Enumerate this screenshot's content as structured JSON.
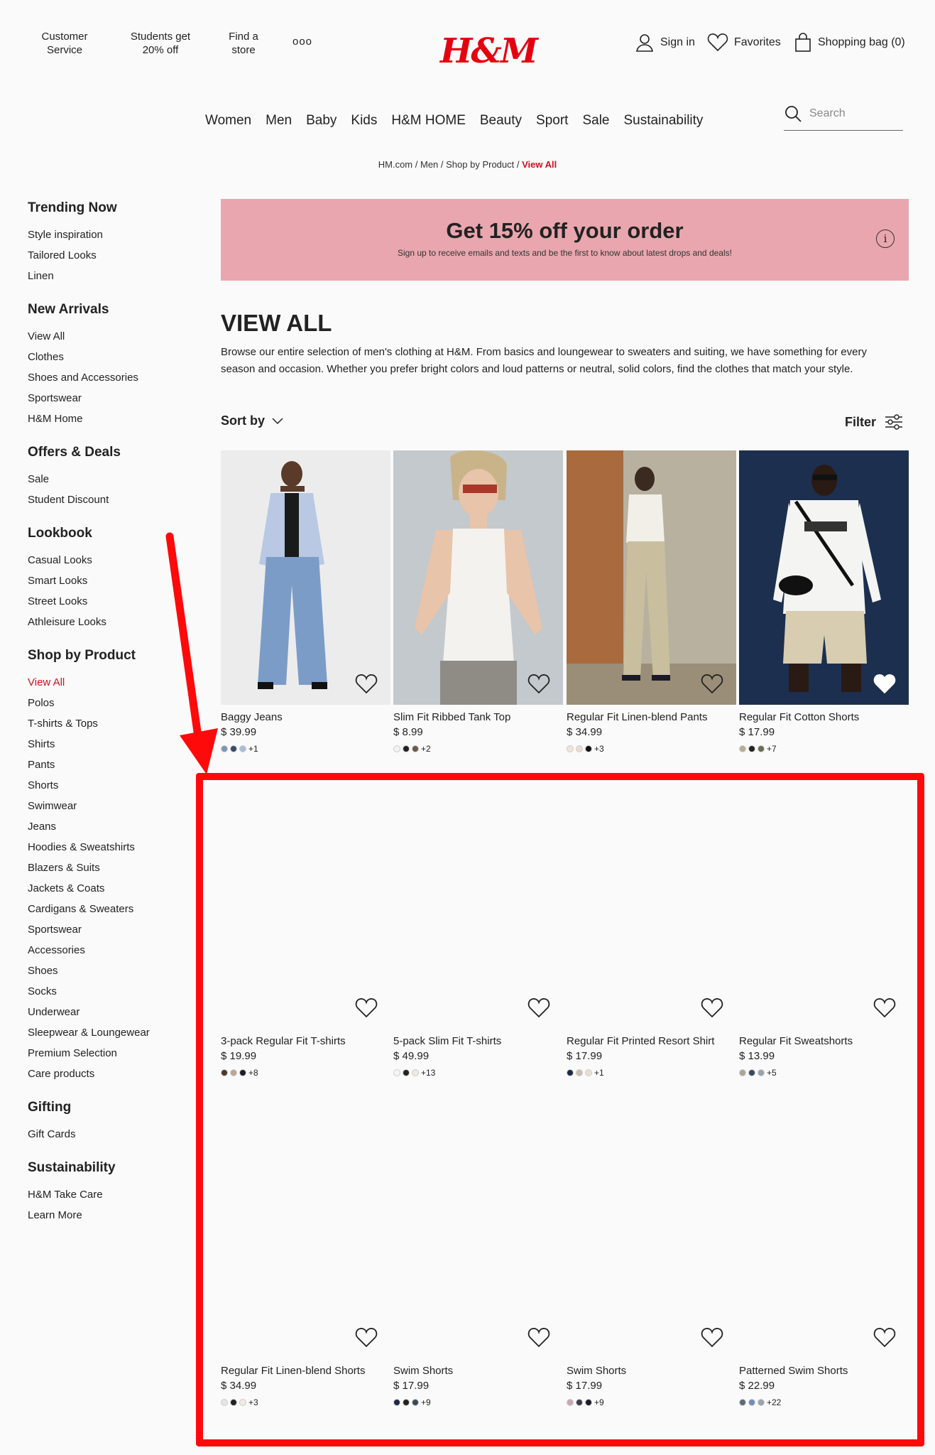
{
  "header": {
    "links": [
      "Customer Service",
      "Students get 20% off",
      "Find a store"
    ],
    "more": "ooo",
    "logo": "H&M",
    "sign_in": "Sign in",
    "favorites": "Favorites",
    "bag": "Shopping bag (0)"
  },
  "nav": [
    "Women",
    "Men",
    "Baby",
    "Kids",
    "H&M HOME",
    "Beauty",
    "Sport",
    "Sale",
    "Sustainability"
  ],
  "search": {
    "placeholder": "Search"
  },
  "breadcrumb": {
    "items": [
      "HM.com",
      "Men",
      "Shop by Product"
    ],
    "current": "View All"
  },
  "sidebar": [
    {
      "title": "Trending Now",
      "items": [
        "Style inspiration",
        "Tailored Looks",
        "Linen"
      ]
    },
    {
      "title": "New Arrivals",
      "items": [
        "View All",
        "Clothes",
        "Shoes and Accessories",
        "Sportswear",
        "H&M Home"
      ]
    },
    {
      "title": "Offers & Deals",
      "items": [
        "Sale",
        "Student Discount"
      ]
    },
    {
      "title": "Lookbook",
      "items": [
        "Casual Looks",
        "Smart Looks",
        "Street Looks",
        "Athleisure Looks"
      ]
    },
    {
      "title": "Shop by Product",
      "items": [
        "View All",
        "Polos",
        "T-shirts & Tops",
        "Shirts",
        "Pants",
        "Shorts",
        "Swimwear",
        "Jeans",
        "Hoodies & Sweatshirts",
        "Blazers & Suits",
        "Jackets & Coats",
        "Cardigans & Sweaters",
        "Sportswear",
        "Accessories",
        "Shoes",
        "Socks",
        "Underwear",
        "Sleepwear & Loungewear",
        "Premium Selection",
        "Care products"
      ]
    },
    {
      "title": "Gifting",
      "items": [
        "Gift Cards"
      ]
    },
    {
      "title": "Sustainability",
      "items": [
        "H&M Take Care",
        "Learn More"
      ]
    }
  ],
  "promo": {
    "title": "Get 15% off your order",
    "subtitle": "Sign up to receive emails and texts and be the first to know about latest drops and deals!"
  },
  "page": {
    "title": "VIEW ALL",
    "description": "Browse our entire selection of men's clothing at H&M. From basics and loungewear to sweaters and suiting, we have something for every season and occasion. Whether you prefer bright colors and loud patterns or neutral, solid colors, find the clothes that match your style.",
    "sort": "Sort by",
    "filter": "Filter"
  },
  "products": [
    {
      "name": "Baggy Jeans",
      "price": "$ 39.99",
      "swatches": [
        "#7e95b8",
        "#3b4a66",
        "#a9bdd6"
      ],
      "more": "+1",
      "bg": "#ececec",
      "image": "jeans"
    },
    {
      "name": "Slim Fit Ribbed Tank Top",
      "price": "$ 8.99",
      "swatches": [
        "#f2f2f2",
        "#222222",
        "#6a5a4a"
      ],
      "more": "+2",
      "bg": "#c3c9cc",
      "image": "tank"
    },
    {
      "name": "Regular Fit Linen-blend Pants",
      "price": "$ 34.99",
      "swatches": [
        "#efe6d6",
        "#e8ddd0",
        "#111111"
      ],
      "more": "+3",
      "bg": "#9a8f7a",
      "image": "linen"
    },
    {
      "name": "Regular Fit Cotton Shorts",
      "price": "$ 17.99",
      "swatches": [
        "#b8ad93",
        "#222222",
        "#6b6b55"
      ],
      "more": "+7",
      "bg": "#1c2f4f",
      "image": "shorts"
    },
    {
      "name": "3-pack Regular Fit T-shirts",
      "price": "$ 19.99",
      "swatches": [
        "#4a3b30",
        "#b7a89a",
        "#1c1c2a"
      ],
      "more": "+8",
      "bg": "#fafafa",
      "image": ""
    },
    {
      "name": "5-pack Slim Fit T-shirts",
      "price": "$ 49.99",
      "swatches": [
        "#f5f5f5",
        "#222222",
        "#efe9df"
      ],
      "more": "+13",
      "bg": "#fafafa",
      "image": ""
    },
    {
      "name": "Regular Fit Printed Resort Shirt",
      "price": "$ 17.99",
      "swatches": [
        "#1e2a44",
        "#c8bfae",
        "#e8e0d2"
      ],
      "more": "+1",
      "bg": "#fafafa",
      "image": ""
    },
    {
      "name": "Regular Fit Sweatshorts",
      "price": "$ 13.99",
      "swatches": [
        "#a6a69a",
        "#3a4a5a",
        "#9aa3ab"
      ],
      "more": "+5",
      "bg": "#fafafa",
      "image": ""
    },
    {
      "name": "Regular Fit Linen-blend Shorts",
      "price": "$ 34.99",
      "swatches": [
        "#e5e5e5",
        "#222222",
        "#f0ebe1"
      ],
      "more": "+3",
      "bg": "#fafafa",
      "image": ""
    },
    {
      "name": "Swim Shorts",
      "price": "$ 17.99",
      "swatches": [
        "#1e2a44",
        "#222222",
        "#3a4a5a"
      ],
      "more": "+9",
      "bg": "#fafafa",
      "image": ""
    },
    {
      "name": "Swim Shorts",
      "price": "$ 17.99",
      "swatches": [
        "#c8a8b0",
        "#3a3a4a",
        "#1c1c2a"
      ],
      "more": "+9",
      "bg": "#fafafa",
      "image": ""
    },
    {
      "name": "Patterned Swim Shorts",
      "price": "$ 22.99",
      "swatches": [
        "#5a6a7a",
        "#6f8fc0",
        "#9aa3ab"
      ],
      "more": "+22",
      "bg": "#fafafa",
      "image": ""
    }
  ],
  "colors": {
    "accent": "#d0101b",
    "promo": "#e9a6ae",
    "annotation": "#ff0a0a"
  }
}
